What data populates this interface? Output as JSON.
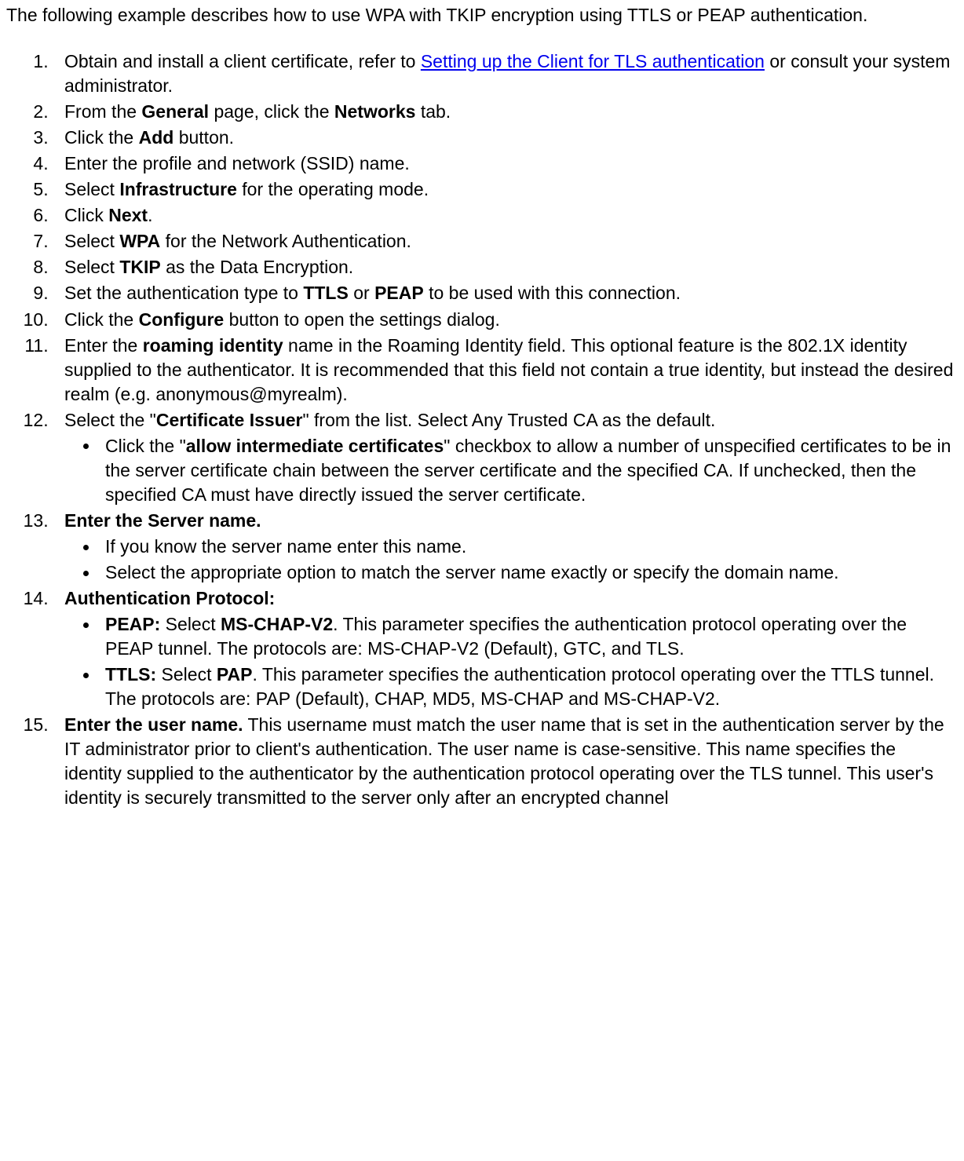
{
  "intro": {
    "text": "The following example describes how to use WPA with TKIP encryption using TTLS or PEAP authentication."
  },
  "steps": {
    "s1": {
      "pre": "Obtain and install a client certificate, refer to ",
      "link": "Setting up the Client for TLS authentication",
      "post": " or consult your system administrator."
    },
    "s2": {
      "a": "From the ",
      "b1": "General",
      "c": " page, click the ",
      "b2": "Networks",
      "d": " tab."
    },
    "s3": {
      "a": "Click the ",
      "b1": "Add",
      "c": " button."
    },
    "s4": {
      "a": "Enter the profile and network (SSID) name."
    },
    "s5": {
      "a": "Select ",
      "b1": "Infrastructure",
      "c": " for the operating mode."
    },
    "s6": {
      "a": "Click ",
      "b1": "Next",
      "c": "."
    },
    "s7": {
      "a": "Select ",
      "b1": "WPA",
      "c": " for the Network Authentication."
    },
    "s8": {
      "a": "Select ",
      "b1": "TKIP",
      "c": " as the Data Encryption."
    },
    "s9": {
      "a": "Set the authentication type to ",
      "b1": "TTLS",
      "c": " or ",
      "b2": "PEAP",
      "d": " to be used with this connection."
    },
    "s10": {
      "a": "Click the ",
      "b1": "Configure",
      "c": " button to open the settings dialog."
    },
    "s11": {
      "a": "Enter the ",
      "b1": "roaming identity",
      "c": " name in the Roaming Identity field. This optional feature is the 802.1X identity supplied to the authenticator. It is recommended that this field not contain a true identity, but instead the desired realm (e.g. anonymous@myrealm)."
    },
    "s12": {
      "a": "Select the \"",
      "b1": "Certificate Issuer",
      "c": "\" from the list. Select Any Trusted CA as the default.",
      "sub1": {
        "a": "Click the \"",
        "b1": "allow intermediate certificates",
        "c": "\" checkbox to allow a number of unspecified certificates to be in the server certificate chain between the server certificate and the specified CA. If unchecked, then the specified CA must have directly issued the server certificate."
      }
    },
    "s13": {
      "b1": "Enter the Server name.",
      "sub1": {
        "a": "If you know the server name enter this name."
      },
      "sub2": {
        "a": "Select the appropriate option to match the server name exactly or specify the domain name."
      }
    },
    "s14": {
      "b1": "Authentication Protocol:",
      "sub1": {
        "b1": "PEAP:",
        "a": " Select ",
        "b2": "MS-CHAP-V2",
        "c": ". This parameter specifies the authentication protocol operating over the PEAP tunnel. The protocols are: MS-CHAP-V2 (Default), GTC, and TLS."
      },
      "sub2": {
        "b1": "TTLS:",
        "a": " Select ",
        "b2": "PAP",
        "c": ". This parameter specifies the authentication protocol operating over the TTLS tunnel. The protocols are: PAP (Default), CHAP, MD5, MS-CHAP and MS-CHAP-V2."
      }
    },
    "s15": {
      "b1": "Enter the user name.",
      "a": " This username must match the user name that is set in the authentication server by the IT administrator prior to client's authentication. The user name is case-sensitive. This name specifies the identity supplied to the authenticator by the authentication protocol operating over the TLS tunnel. This user's identity is securely transmitted to the server only after an encrypted channel"
    }
  }
}
